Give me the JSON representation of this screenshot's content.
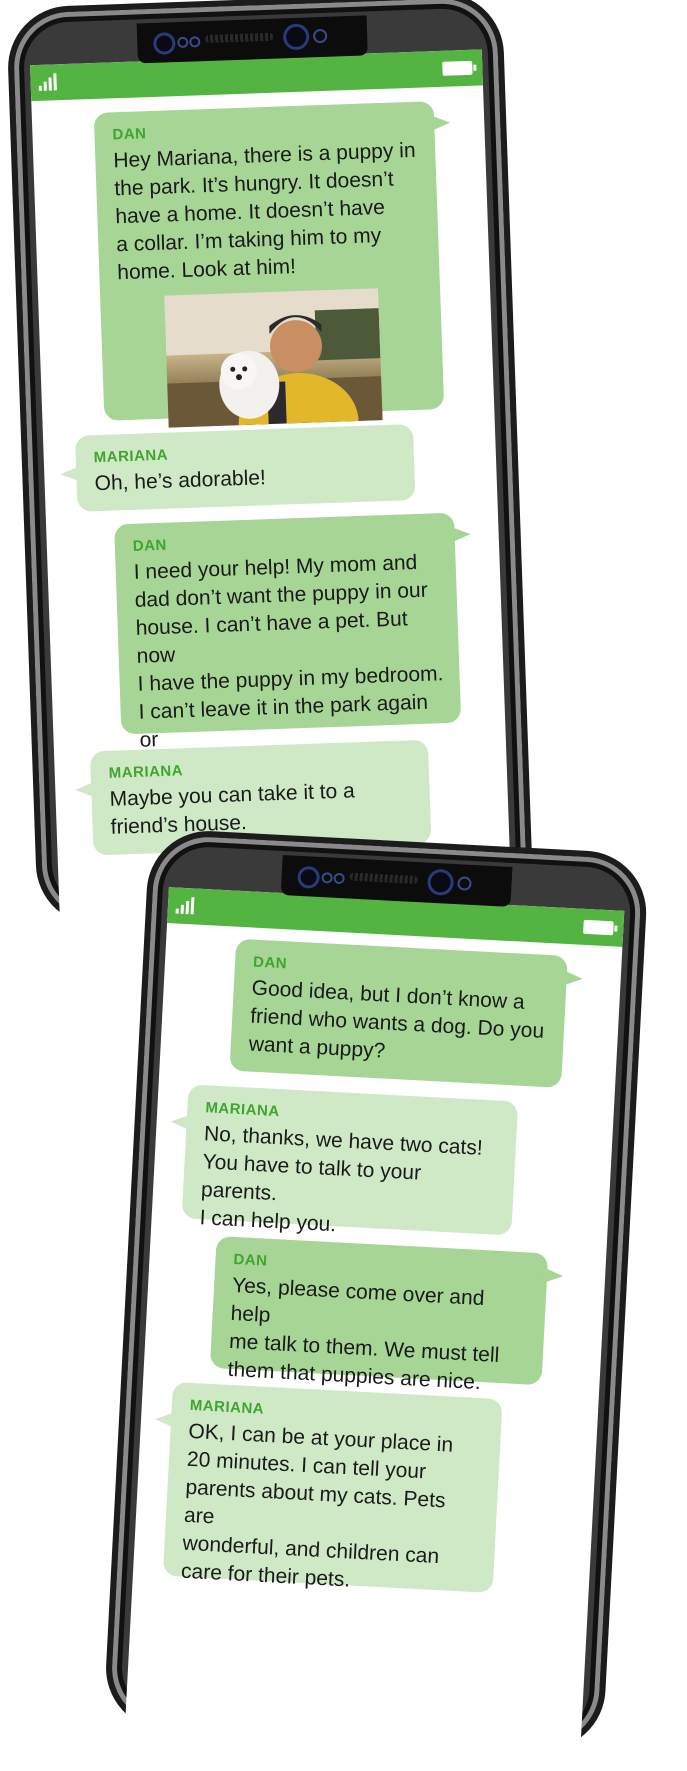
{
  "phone1": {
    "messages": [
      {
        "sender": "DAN",
        "text": "Hey Mariana, there is a puppy in\nthe park. It’s hungry. It doesn’t\nhave a home. It doesn’t have\na collar. I’m taking him to my\nhome. Look at him!"
      },
      {
        "sender": "MARIANA",
        "text": "Oh, he’s adorable!"
      },
      {
        "sender": "DAN",
        "text": "I need your help! My mom and\ndad don’t want the puppy in our\nhouse. I can’t have a pet. But now\nI have the puppy in my bedroom.\nI can’t leave it in the park again or\non the street! What can I do?"
      },
      {
        "sender": "MARIANA",
        "text": "Maybe you can take it to a\nfriend’s house."
      }
    ]
  },
  "phone2": {
    "messages": [
      {
        "sender": "DAN",
        "text": "Good idea, but I don’t know a\nfriend who wants a dog. Do you\nwant a puppy?"
      },
      {
        "sender": "MARIANA",
        "text": "No, thanks, we have two cats!\nYou have to talk to your parents.\nI can help you."
      },
      {
        "sender": "DAN",
        "text": "Yes, please come over and help\nme talk to them. We must tell\nthem that puppies are nice."
      },
      {
        "sender": "MARIANA",
        "text": "OK, I can be at your place in\n20 minutes. I can tell your\nparents about my cats. Pets are\nwonderful, and children can\ncare for their pets."
      }
    ]
  },
  "colors": {
    "accent": "#54b442",
    "dan_bubble": "#a6d596",
    "mariana_bubble": "#cfe8c6",
    "sender_text": "#3fa52e"
  }
}
